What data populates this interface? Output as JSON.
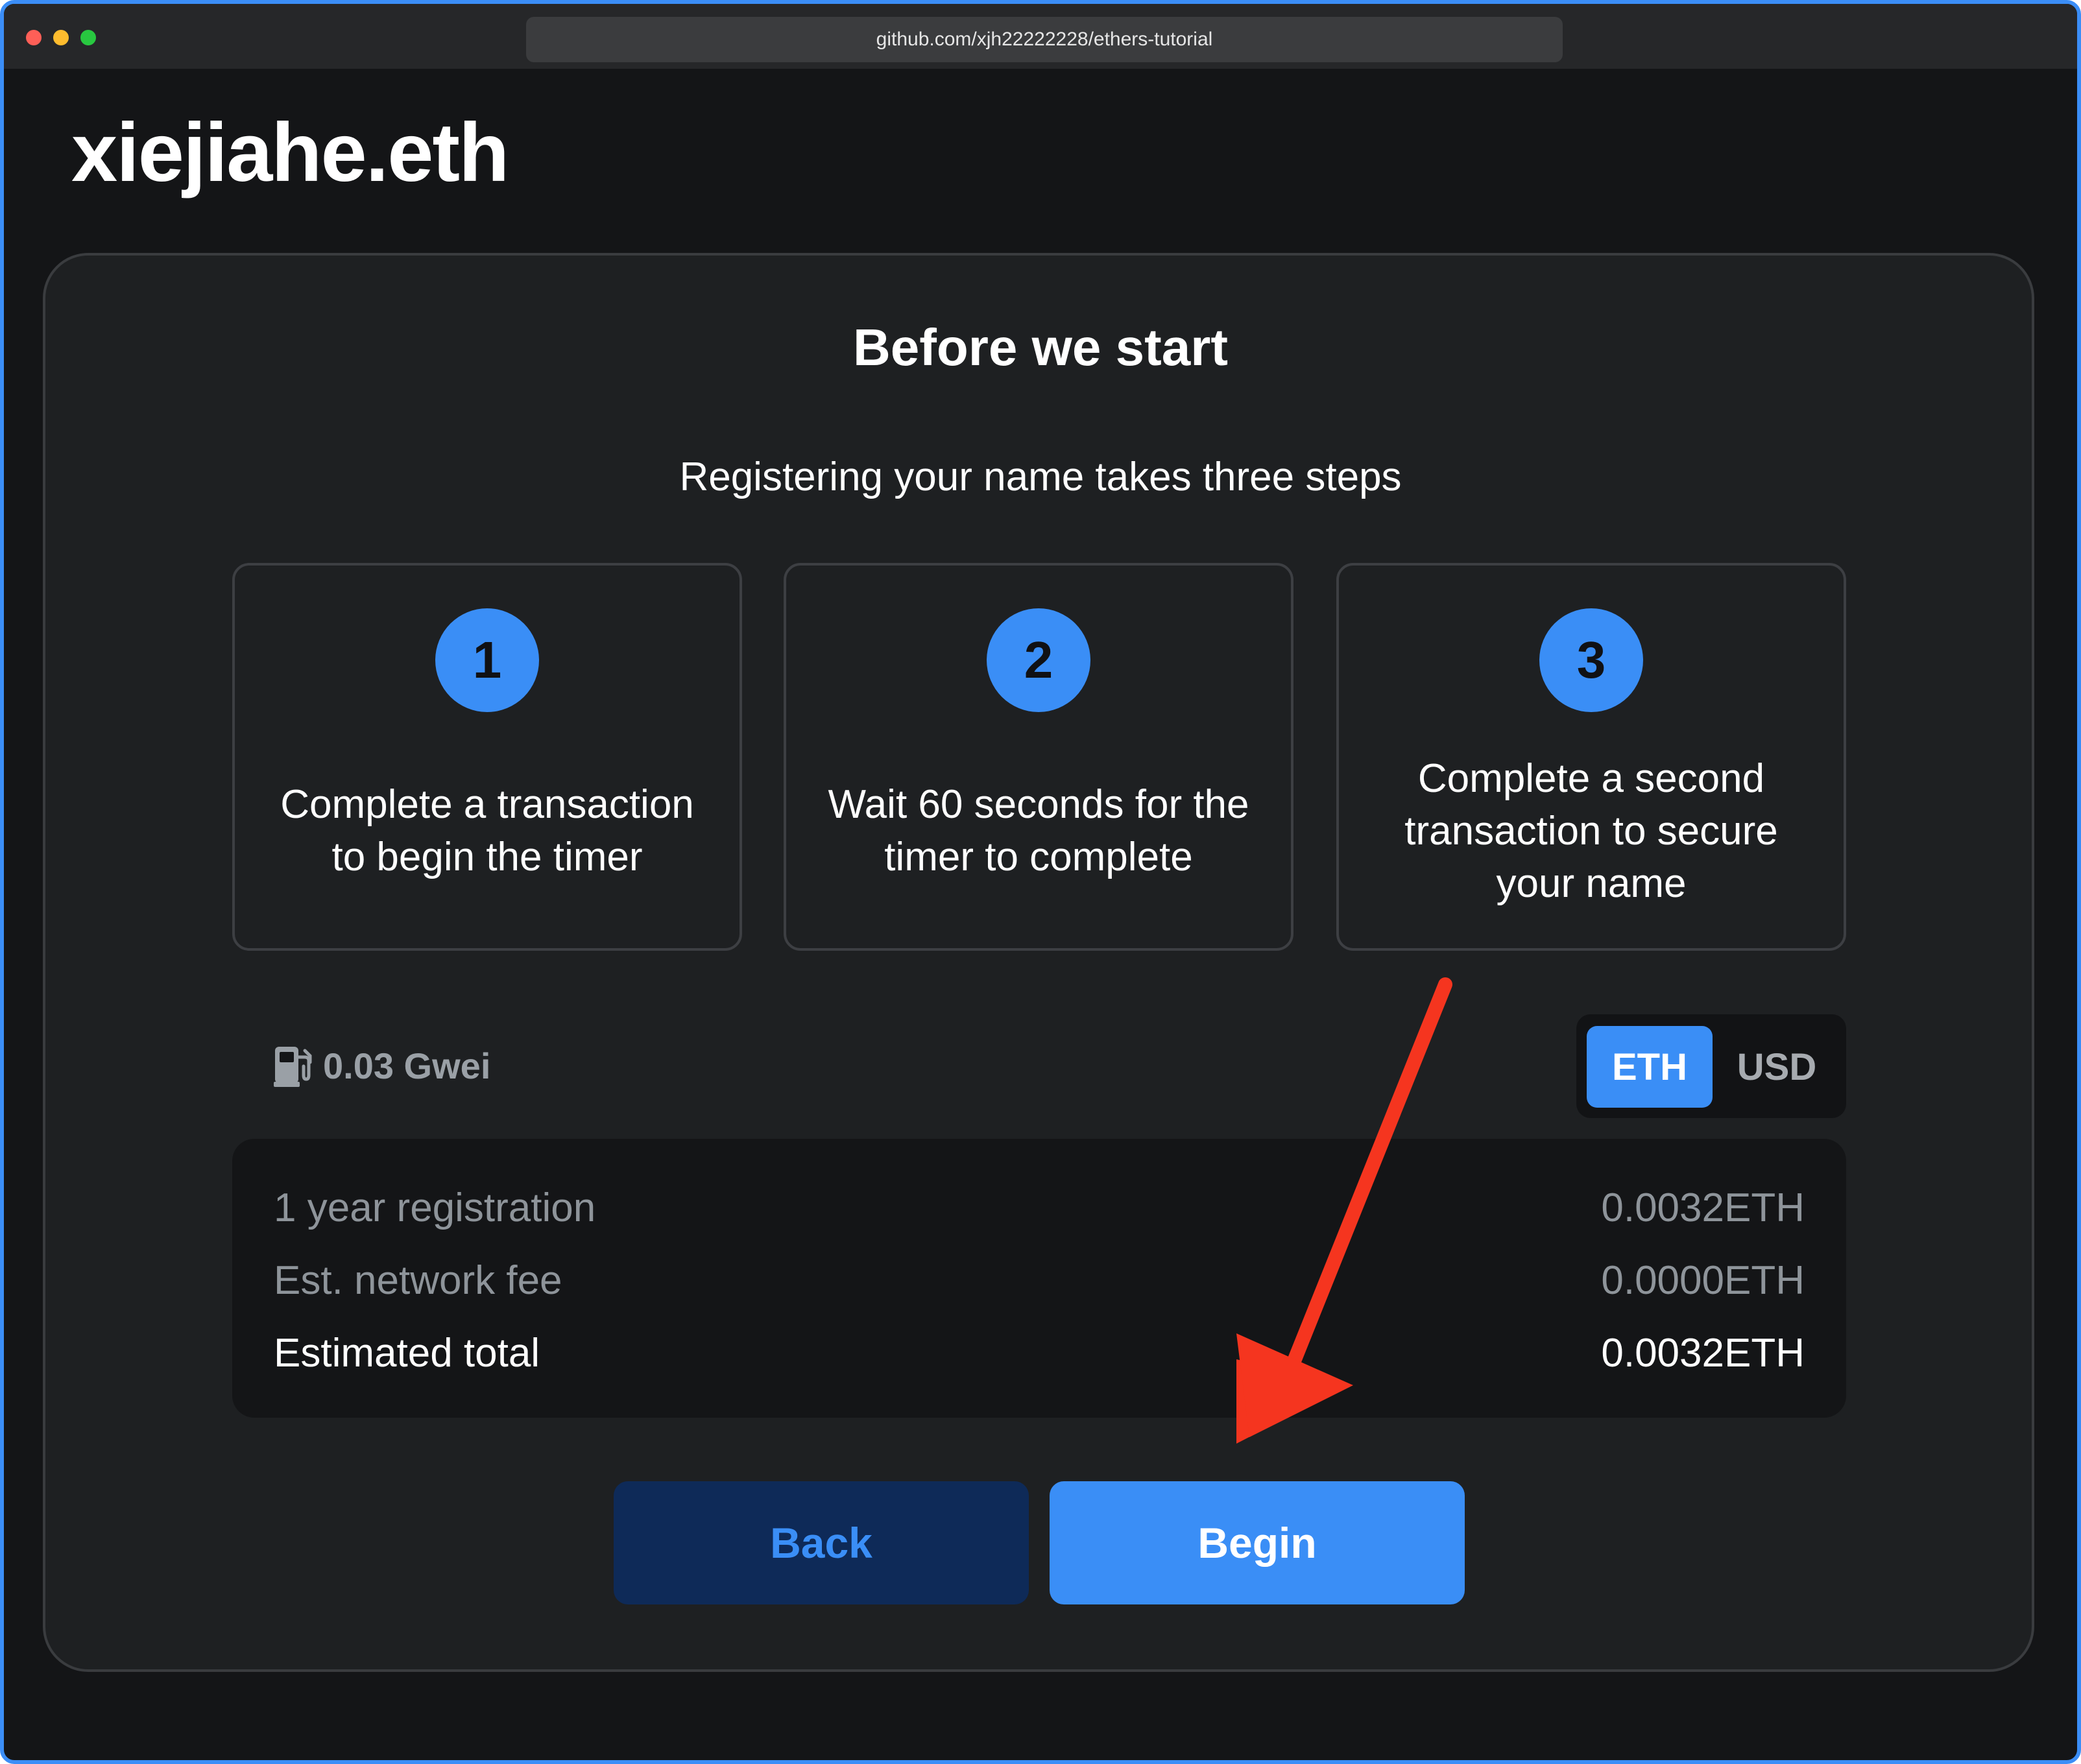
{
  "browser": {
    "url": "github.com/xjh22222228/ethers-tutorial"
  },
  "header": {
    "site_name": "xiejiahe.eth"
  },
  "card": {
    "title": "Before we start",
    "subtitle": "Registering your name takes three steps"
  },
  "steps": [
    {
      "number": "1",
      "text": "Complete a transaction to begin the timer"
    },
    {
      "number": "2",
      "text": "Wait 60 seconds for the timer to complete"
    },
    {
      "number": "3",
      "text": "Complete a second transaction to secure your name"
    }
  ],
  "gas": {
    "icon": "gas-pump-icon",
    "value": "0.03 Gwei"
  },
  "currency_toggle": {
    "options": [
      "ETH",
      "USD"
    ],
    "selected": "ETH"
  },
  "summary": {
    "rows": [
      {
        "label": "1 year registration",
        "value": "0.0032ETH"
      },
      {
        "label": "Est. network fee",
        "value": "0.0000ETH"
      },
      {
        "label": "Estimated total",
        "value": "0.0032ETH"
      }
    ]
  },
  "actions": {
    "back_label": "Back",
    "begin_label": "Begin"
  },
  "colors": {
    "accent": "#3a8ef6",
    "annotation_arrow": "#f5351f",
    "background": "#141517",
    "card": "#1e2022"
  }
}
